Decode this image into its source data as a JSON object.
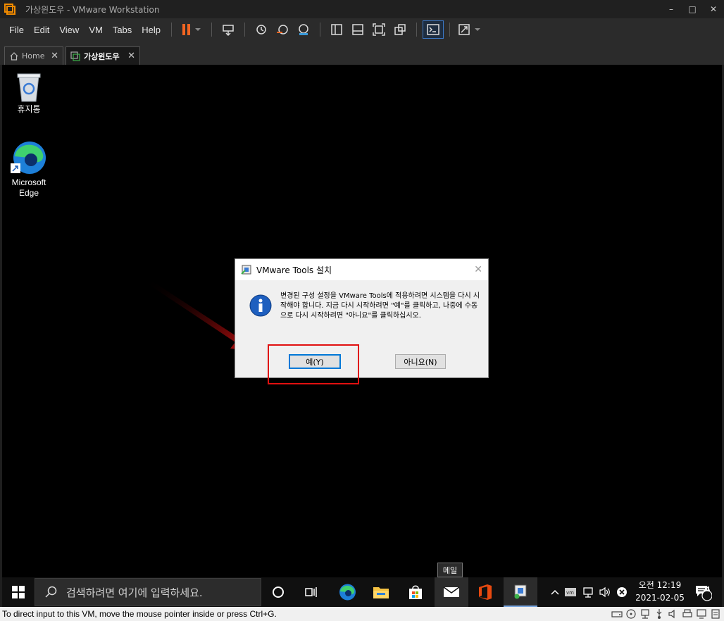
{
  "window": {
    "title": "가상윈도우 - VMware Workstation",
    "minimize": "–",
    "maximize": "□",
    "close": "✕"
  },
  "menu": [
    "File",
    "Edit",
    "View",
    "VM",
    "Tabs",
    "Help"
  ],
  "tabs": [
    {
      "label": "Home",
      "close": "✕"
    },
    {
      "label": "가상윈도우",
      "close": "✕"
    }
  ],
  "desktop": {
    "icons": [
      {
        "label": "휴지통",
        "icon": "recycle-bin-icon"
      },
      {
        "label": "Microsoft\nEdge",
        "icon": "edge-icon"
      }
    ]
  },
  "dialog": {
    "title": "VMware Tools 설치",
    "message": "변경된 구성 설정을 VMware Tools에 적용하려면 시스템을 다시 시작해야 합니다. 지금 다시 시작하려면 \"예\"를 클릭하고, 나중에 수동으로 다시 시작하려면 \"아니요\"를 클릭하십시오.",
    "yes_label": "예(Y)",
    "no_label": "아니요(N)",
    "close": "✕"
  },
  "taskbar": {
    "search_placeholder": "검색하려면 여기에 입력하세요.",
    "tooltip": "메일",
    "time": "오전 12:19",
    "date": "2021-02-05",
    "notification_count": "4"
  },
  "statusbar": {
    "text": "To direct input to this VM, move the mouse pointer inside or press Ctrl+G."
  },
  "colors": {
    "accent": "#0078d7",
    "highlight_red": "#e01010",
    "pause_orange": "#f26522"
  }
}
